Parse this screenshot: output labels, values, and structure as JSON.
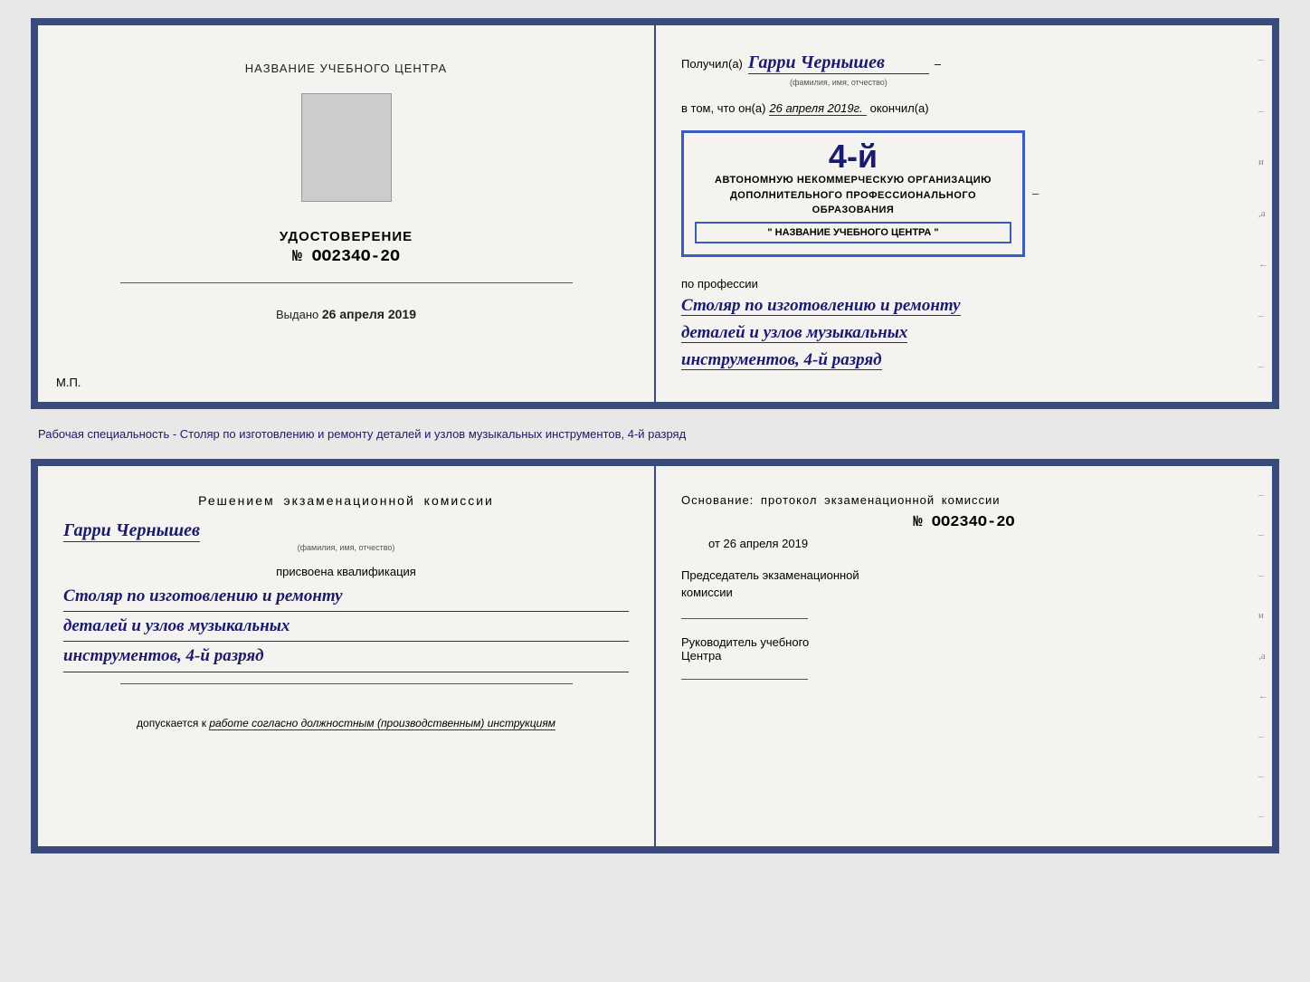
{
  "top_doc": {
    "left": {
      "title": "НАЗВАНИЕ УЧЕБНОГО ЦЕНТРА",
      "udostoverenie_label": "УДОСТОВЕРЕНИЕ",
      "number": "№ OO234O-2O",
      "vydano_label": "Выдано",
      "vydano_date": "26 апреля 2019",
      "mp_label": "М.П."
    },
    "right": {
      "poluchil_label": "Получил(а)",
      "recipient_name": "Гарри Чернышев",
      "fio_label": "(фамилия, имя, отчество)",
      "vtom_prefix": "в том, что он(а)",
      "vtom_date": "26 апреля 2019г.",
      "okonchil_label": "окончил(а)",
      "stamp_4y": "4-й",
      "stamp_line1a": "АВТОНОМНУЮ НЕКОММЕРЧЕСКУЮ ОРГАНИЗАЦИЮ",
      "stamp_line1b": "ДОПОЛНИТЕЛЬНОГО ПРОФЕССИОНАЛЬНОГО ОБРАЗОВАНИЯ",
      "stamp_name": "\" НАЗВАНИЕ УЧЕБНОГО ЦЕНТРА \"",
      "po_professii": "по профессии",
      "prof_line1": "Столяр по изготовлению и ремонту",
      "prof_line2": "деталей и узлов музыкальных",
      "prof_line3": "инструментов, 4-й разряд"
    }
  },
  "separator": {
    "text": "Рабочая специальность - Столяр по изготовлению и ремонту деталей и узлов музыкальных инструментов, 4-й разряд"
  },
  "bottom_doc": {
    "left": {
      "resheniem_title": "Решением  экзаменационной  комиссии",
      "person_name": "Гарри Чернышев",
      "fio_label": "(фамилия, имя, отчество)",
      "prisvoena": "присвоена квалификация",
      "kvalif_line1": "Столяр по изготовлению и ремонту",
      "kvalif_line2": "деталей и узлов музыкальных",
      "kvalif_line3": "инструментов, 4-й разряд",
      "dopusk_prefix": "допускается к",
      "dopusk_italic": "работе согласно должностным (производственным) инструкциям"
    },
    "right": {
      "osnovanie": "Основание:  протокол  экзаменационной  комиссии",
      "protocol_number": "№ OO234O-2O",
      "ot_label": "от",
      "ot_date": "26 апреля 2019",
      "predsedatel_line1": "Председатель экзаменационной",
      "predsedatel_line2": "комиссии",
      "rukovoditel_line1": "Руководитель учебного",
      "rukovoditel_line2": "Центра"
    }
  },
  "right_edge_chars": [
    "–",
    "–",
    "и",
    ",а",
    "←",
    "–",
    "–",
    "–",
    "–"
  ],
  "right_edge_chars2": [
    "–",
    "–",
    "–",
    "и",
    ",а",
    "←",
    "–",
    "–",
    "–",
    "–"
  ]
}
